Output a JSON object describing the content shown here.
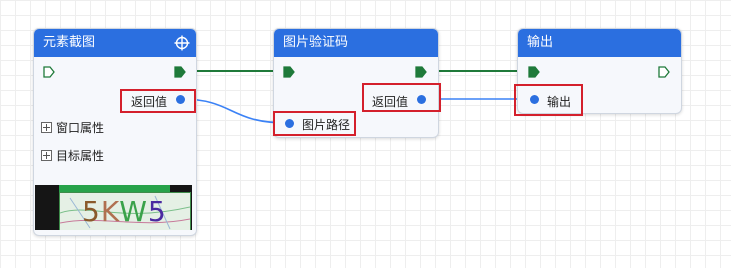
{
  "nodes": {
    "element_screenshot": {
      "title": "元素截图",
      "return_label": "返回值",
      "window_attr": "窗口属性",
      "target_attr": "目标属性",
      "captcha_text": "5KW5"
    },
    "image_captcha": {
      "title": "图片验证码",
      "input_label": "图片路径",
      "return_label": "返回值"
    },
    "output": {
      "title": "输出",
      "input_label": "输出"
    }
  },
  "colors": {
    "header": "#2b6fe0",
    "exec_active": "#1f7a3a",
    "data_wire": "#3b82f6",
    "highlight": "#d4202c"
  },
  "icons": [
    "crosshair-icon",
    "exec-port-icon",
    "data-port-icon",
    "expand-icon"
  ]
}
